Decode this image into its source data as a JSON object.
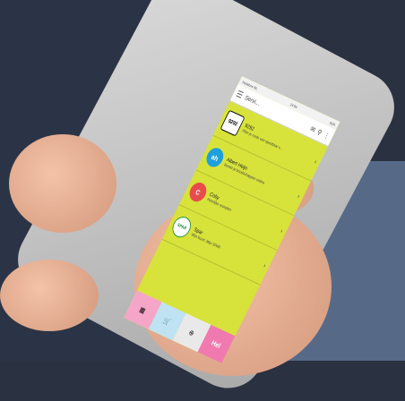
{
  "status": {
    "carrier": "Vodafone NL",
    "time": "14:04",
    "battery": "91%"
  },
  "appbar": {
    "title": "Servi...",
    "menu_icon": "hamburger-icon",
    "mail_icon": "mail-icon",
    "search_icon": "search-icon",
    "more_icon": "more-icon"
  },
  "list": [
    {
      "name": "9292",
      "sub": "Plan je route van openbaar v...",
      "color": "#ffffff",
      "logo": "9292"
    },
    {
      "name": "Albert Heijn",
      "sub": "Bestel je boodschappen online",
      "color": "#1ea0dc",
      "logo": "ah"
    },
    {
      "name": "Coby",
      "sub": "Heerlijke recepten",
      "color": "#e84b4b",
      "logo": "C"
    },
    {
      "name": "Spar",
      "sub": "Mijn buurt, Mijn SPAR",
      "color": "#1e8f3a",
      "logo": "SPAR"
    }
  ],
  "bottom": {
    "help": "Hel"
  },
  "colors": {
    "screen": "#d7e33a",
    "pink": "#f07ab0"
  }
}
